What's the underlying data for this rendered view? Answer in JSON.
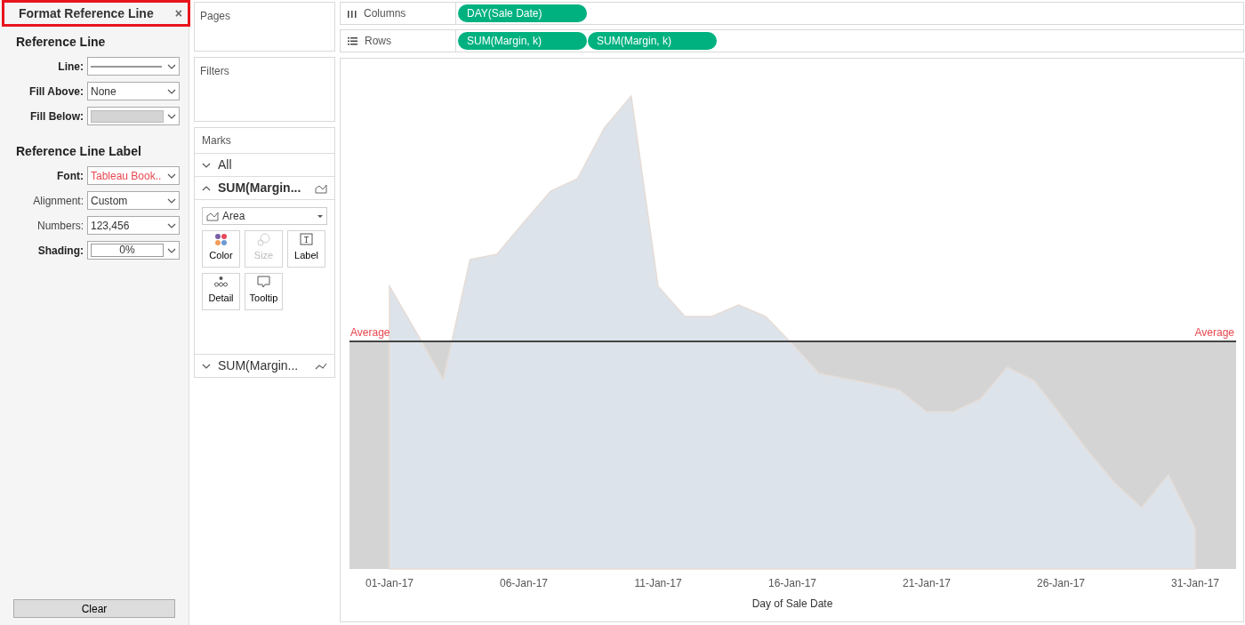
{
  "format_panel": {
    "title": "Format Reference Line",
    "close": "×",
    "sections": [
      {
        "heading": "Reference Line",
        "fields": [
          {
            "label": "Line:",
            "kind": "line",
            "emphasized": true
          },
          {
            "label": "Fill Above:",
            "kind": "select",
            "value": "None",
            "emphasized": true
          },
          {
            "label": "Fill Below:",
            "kind": "swatch",
            "emphasized": true
          }
        ]
      },
      {
        "heading": "Reference Line Label",
        "fields": [
          {
            "label": "Font:",
            "kind": "select",
            "value": "Tableau Book..",
            "emphasized": true,
            "color": "#e8474f"
          },
          {
            "label": "Alignment:",
            "kind": "select",
            "value": "Custom",
            "emphasized": false
          },
          {
            "label": "Numbers:",
            "kind": "select",
            "value": "123,456",
            "emphasized": false
          },
          {
            "label": "Shading:",
            "kind": "shading",
            "value": "0%",
            "emphasized": true
          }
        ]
      }
    ],
    "clear_button": "Clear"
  },
  "pages": {
    "title": "Pages"
  },
  "filters": {
    "title": "Filters"
  },
  "shelves": [
    {
      "kind": "columns",
      "label": "Columns",
      "pills": [
        "DAY(Sale Date)"
      ]
    },
    {
      "kind": "rows",
      "label": "Rows",
      "pills": [
        "SUM(Margin, k)",
        "SUM(Margin, k)"
      ]
    }
  ],
  "marks": {
    "title": "Marks",
    "cards": [
      {
        "label": "All",
        "expanded": false,
        "kind": "all"
      },
      {
        "label": "SUM(Margin...",
        "expanded": true,
        "kind": "area",
        "mark_type": "Area",
        "buttons": [
          {
            "label": "Color",
            "kind": "color",
            "disabled": false
          },
          {
            "label": "Size",
            "kind": "size",
            "disabled": true
          },
          {
            "label": "Label",
            "kind": "label",
            "disabled": false
          },
          {
            "label": "Detail",
            "kind": "detail",
            "disabled": false
          },
          {
            "label": "Tooltip",
            "kind": "tooltip",
            "disabled": false
          }
        ]
      },
      {
        "label": "SUM(Margin...",
        "expanded": false,
        "kind": "line"
      }
    ]
  },
  "view": {
    "reference_label_left": "Average",
    "reference_label_right": "Average",
    "x_tick_labels": [
      "01-Jan-17",
      "06-Jan-17",
      "11-Jan-17",
      "16-Jan-17",
      "21-Jan-17",
      "26-Jan-17",
      "31-Jan-17"
    ],
    "x_axis_title": "Day of Sale Date"
  }
}
